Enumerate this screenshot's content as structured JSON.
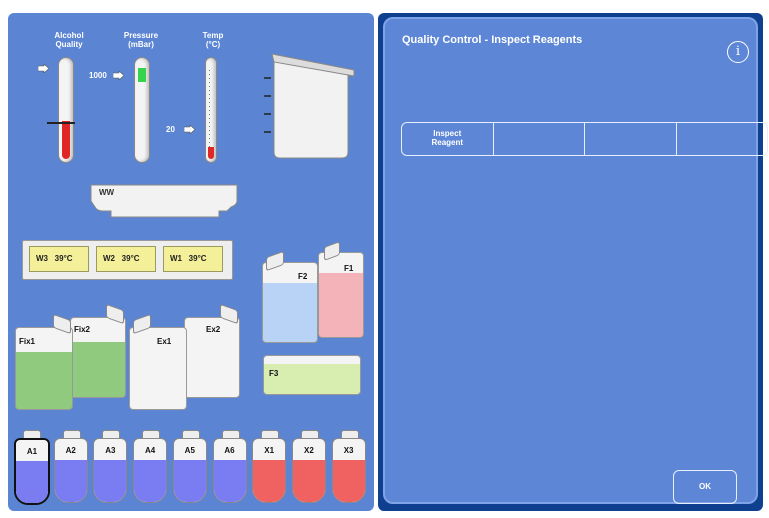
{
  "gauges": {
    "alcohol": {
      "label_line1": "Alcohol",
      "label_line2": "Quality",
      "level": 0.28
    },
    "pressure": {
      "label_line1": "Pressure",
      "label_line2": "(mBar)",
      "value": "1000"
    },
    "temp": {
      "label_line1": "Temp",
      "label_line2": "(°C)",
      "value": "20"
    }
  },
  "waste": {
    "label": "WW"
  },
  "wax_baths": [
    {
      "label": "W3",
      "temp": "39°C"
    },
    {
      "label": "W2",
      "temp": "39°C"
    },
    {
      "label": "W1",
      "temp": "39°C"
    }
  ],
  "flasks": {
    "f1": "F1",
    "f2": "F2",
    "f3": "F3"
  },
  "fixative": {
    "fix1": "Fix1",
    "fix2": "Fix2"
  },
  "exchange": {
    "ex1": "Ex1",
    "ex2": "Ex2"
  },
  "bottles": [
    {
      "label": "A1",
      "color": "#7a7cf2"
    },
    {
      "label": "A2",
      "color": "#7a7cf2"
    },
    {
      "label": "A3",
      "color": "#7a7cf2"
    },
    {
      "label": "A4",
      "color": "#7a7cf2"
    },
    {
      "label": "A5",
      "color": "#7a7cf2"
    },
    {
      "label": "A6",
      "color": "#7a7cf2"
    },
    {
      "label": "X1",
      "color": "#f06262"
    },
    {
      "label": "X2",
      "color": "#f06262"
    },
    {
      "label": "X3",
      "color": "#f06262"
    }
  ],
  "panel": {
    "title": "Quality Control - Inspect Reagents",
    "info_icon": "i",
    "tabs": [
      "Inspect\nReagent",
      "",
      "",
      ""
    ],
    "ok_label": "OK"
  },
  "colors": {
    "green_reagent": "#8fca7e",
    "blue_flask": "#b9d3f7",
    "pink_flask": "#f4b3b8",
    "f3_fill": "#d8edb0",
    "wax_yellow": "#f4f09a"
  }
}
